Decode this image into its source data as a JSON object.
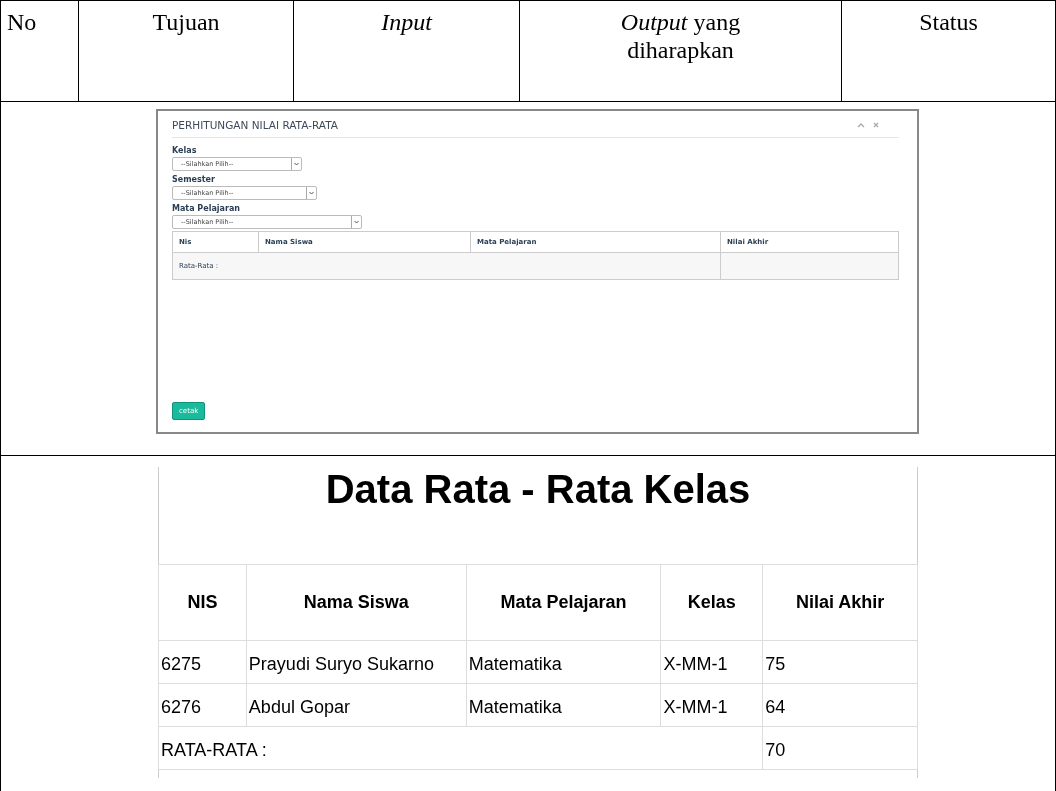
{
  "header": {
    "columns": [
      {
        "label": "No"
      },
      {
        "label": "Tujuan"
      },
      {
        "label": "*Input*"
      },
      {
        "label": "*Output* yang diharapkan"
      },
      {
        "label": "Status"
      }
    ]
  },
  "form_screen": {
    "title": "PERHITUNGAN NILAI RATA-RATA",
    "fields": [
      {
        "label": "Kelas",
        "placeholder": "--Silahkan Pilih--"
      },
      {
        "label": "Semester",
        "placeholder": "--Silahkan Pilih--"
      },
      {
        "label": "Mata Pelajaran",
        "placeholder": "--Silahkan Pilih--"
      }
    ],
    "table": {
      "columns": [
        "Nis",
        "Nama Siswa",
        "Mata Pelajaran",
        "Nilai Akhir"
      ],
      "footer_label": "Rata-Rata :"
    },
    "button": "cetak"
  },
  "report": {
    "title": "Data Rata - Rata Kelas",
    "columns": [
      "NIS",
      "Nama Siswa",
      "Mata Pelajaran",
      "Kelas",
      "Nilai Akhir"
    ],
    "rows": [
      [
        "6275",
        "Prayudi Suryo Sukarno",
        "Matematika",
        "X-MM-1",
        "75"
      ],
      [
        "6276",
        "Abdul Gopar",
        "Matematika",
        "X-MM-1",
        "64"
      ]
    ],
    "footer": {
      "label": "RATA-RATA :",
      "value": "70"
    }
  }
}
